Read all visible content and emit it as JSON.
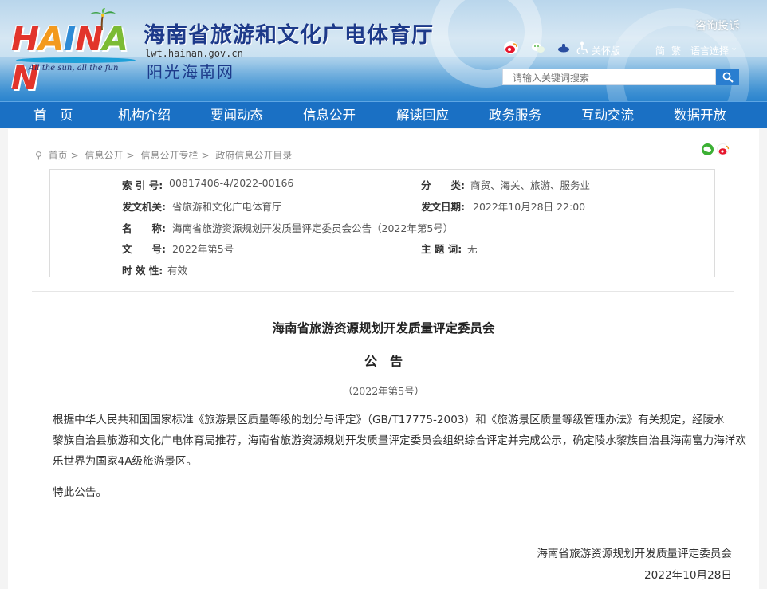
{
  "header": {
    "logo_text": "HAINAN",
    "logo_slogan": "All the sun, all the fun",
    "site_title": "海南省旅游和文化广电体育厅",
    "site_url": "lwt.hainan.gov.cn",
    "site_subtitle": "阳光海南网",
    "complaint_link": "咨询投诉",
    "accessibility_label": "关怀版",
    "simplified_label": "简",
    "traditional_label": "繁",
    "language_label": "语言选择",
    "search_placeholder": "请输入关键词搜索"
  },
  "nav": {
    "items": [
      "首　页",
      "机构介绍",
      "要闻动态",
      "信息公开",
      "解读回应",
      "政务服务",
      "互动交流",
      "数据开放"
    ]
  },
  "breadcrumb": [
    "首页",
    "信息公开",
    "信息公开专栏",
    "政府信息公开目录"
  ],
  "meta": {
    "index_label": "索 引 号:",
    "index_value": "00817406-4/2022-00166",
    "category_label": "分　　类:",
    "category_value": "商贸、海关、旅游、服务业",
    "issuer_label": "发文机关:",
    "issuer_value": "省旅游和文化广电体育厅",
    "date_label": "发文日期:",
    "date_value": "2022年10月28日 22:00",
    "name_label": "名　　称:",
    "name_value": "海南省旅游资源规划开发质量评定委员会公告（2022年第5号）",
    "docno_label": "文　　号:",
    "docno_value": "2022年第5号",
    "subject_label": "主 题 词:",
    "subject_value": "无",
    "validity_label": "时 效 性:",
    "validity_value": "有效"
  },
  "article": {
    "org_title": "海南省旅游资源规划开发质量评定委员会",
    "announce_title": "公　告",
    "doc_number": "（2022年第5号）",
    "body_lines": [
      "根据中华人民共和国国家标准《旅游景区质量等级的划分与评定》（GB/T17775-2003）和《旅游景区质量等级管理办法》有关规定，经陵水",
      "黎族自治县旅游和文化广电体育局推荐，海南省旅游资源规划开发质量评定委员会组织综合评定并完成公示，确定陵水黎族自治县海南富力海洋欢",
      "乐世界为国家4A级旅游景区。"
    ],
    "closing": "特此公告。",
    "signature_org": "海南省旅游资源规划开发质量评定委员会",
    "signature_date": "2022年10月28日"
  },
  "colors": {
    "nav_bg": "#1a70c4",
    "title_blue": "#1d3a8a",
    "search_btn": "#2a7ed0"
  }
}
